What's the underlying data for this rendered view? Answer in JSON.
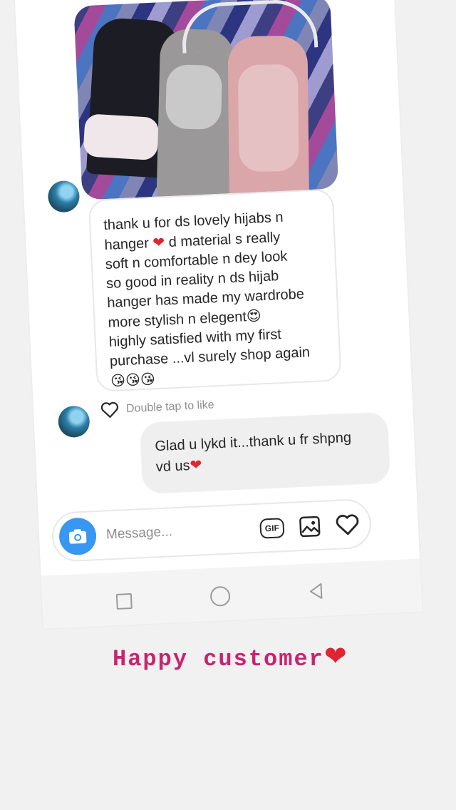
{
  "incoming_message": {
    "lines": [
      "thank u for ds lovely hijabs n",
      "hanger",
      "d material s really",
      "soft n comfortable n dey look",
      "so good in reality n ds hijab",
      "hanger has made my wardrobe",
      "more stylish n elegent",
      "highly satisfied with my first",
      "purchase ...vl surely shop again"
    ],
    "emoji_heart": "❤",
    "emoji_heart_eyes": "😍",
    "emoji_kiss": "😘😘😘"
  },
  "like_hint": "Double tap to like",
  "outgoing_message": {
    "lines": [
      "Glad u lykd it...thank u fr shpng",
      "vd us"
    ],
    "emoji_heart": "❤"
  },
  "composer": {
    "placeholder": "Message...",
    "gif_label": "GIF",
    "camera_icon": "camera-icon",
    "gallery_icon": "image-icon",
    "like_icon": "heart-outline-icon"
  },
  "navbar": {
    "icons": [
      "recent-apps-icon",
      "home-icon",
      "back-icon"
    ]
  },
  "caption": {
    "text": "Happy customer",
    "emoji": "❤",
    "color": "#c8246f"
  },
  "colors": {
    "accent": "#3897f0",
    "heart": "#e0252e"
  }
}
